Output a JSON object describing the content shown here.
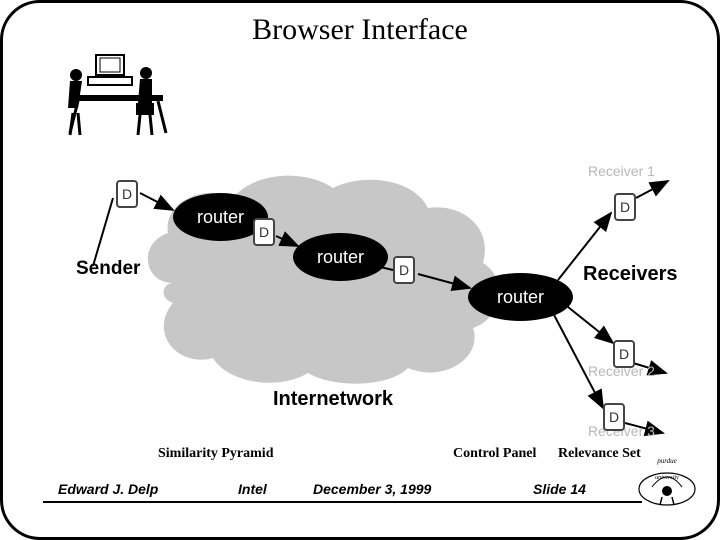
{
  "title": "Browser Interface",
  "diagram": {
    "sender_label": "Sender",
    "receivers_label": "Receivers",
    "internetwork_label": "Internetwork",
    "router_label": "router",
    "packet_symbol": "D",
    "receiver1_label": "Receiver 1",
    "receiver2_label": "Receiver 2",
    "receiver3_label": "Receiver 3"
  },
  "captions": {
    "similarity_pyramid": "Similarity Pyramid",
    "control_panel": "Control Panel",
    "relevance_set": "Relevance Set"
  },
  "footer": {
    "author": "Edward J. Delp",
    "org": "Intel",
    "date": "December 3, 1999",
    "slide": "Slide 14"
  }
}
